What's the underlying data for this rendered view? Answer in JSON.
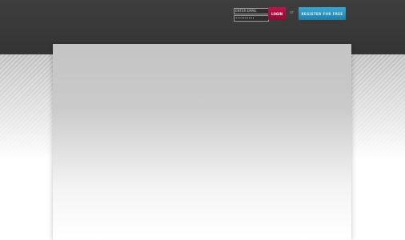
{
  "header": {
    "login": {
      "username_value": "ENTER EMAIL",
      "password_value": "••••••••••",
      "login_label": "LOGIN",
      "or_label": "or",
      "register_label": "REGISTER FOR FREE"
    }
  },
  "colors": {
    "header_bg": "#3a3a3a",
    "login_button": "#a8103f",
    "register_button": "#2b92bd",
    "panel_top": "#c4c4c4",
    "page_bg": "#ffffff"
  }
}
